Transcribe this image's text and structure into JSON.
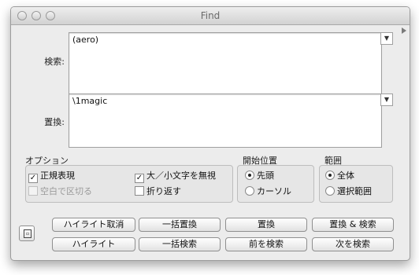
{
  "window": {
    "title": "Find"
  },
  "search": {
    "label": "検索:",
    "value": "(aero)"
  },
  "replace": {
    "label": "置換:",
    "value": "\\1magic"
  },
  "options": {
    "heading": "オプション",
    "regex": {
      "label": "正規表現",
      "checked": true
    },
    "case_insensitive": {
      "label": "大／小文字を無視",
      "checked": true
    },
    "whitespace": {
      "label": "空白で区切る",
      "checked": false,
      "enabled": false
    },
    "wrap": {
      "label": "折り返す",
      "checked": false
    }
  },
  "start_position": {
    "heading": "開始位置",
    "items": [
      {
        "label": "先頭",
        "selected": true
      },
      {
        "label": "カーソル",
        "selected": false
      }
    ]
  },
  "scope": {
    "heading": "範囲",
    "items": [
      {
        "label": "全体",
        "selected": true
      },
      {
        "label": "選択範囲",
        "selected": false
      }
    ]
  },
  "buttons": {
    "highlight_cancel": "ハイライト取消",
    "replace_all": "一括置換",
    "replace": "置換",
    "replace_and_find": "置換 & 検索",
    "highlight": "ハイライト",
    "find_all": "一括検索",
    "find_prev": "前を検索",
    "find_next": "次を検索"
  },
  "icons": {
    "dropdown": "chevron-down-icon",
    "resize": "triangle-right-icon",
    "panel": "panel-toggle-icon"
  }
}
